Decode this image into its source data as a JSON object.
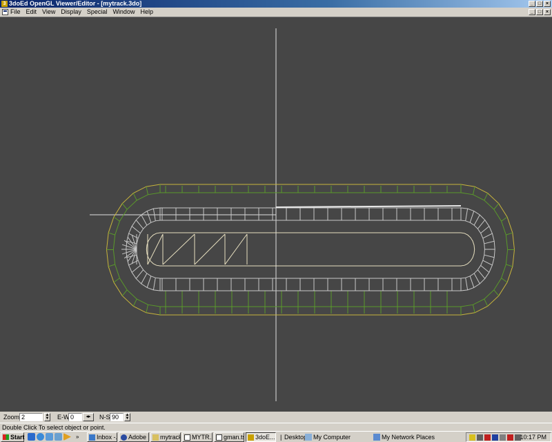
{
  "window": {
    "title": "3doEd OpenGL Viewer/Editor - [mytrack.3do]",
    "icon": "3",
    "controls": [
      "_",
      "□",
      "×"
    ]
  },
  "menu": {
    "items": [
      "File",
      "Edit",
      "View",
      "Display",
      "Special",
      "Window",
      "Help"
    ],
    "doc_controls": [
      "_",
      "□",
      "×"
    ]
  },
  "viewport": {
    "background": "#464646",
    "colors": {
      "axis": "#e0e0e0",
      "inner_wire": "#c8c8c8",
      "outer_wire": "#5a9a2a",
      "outline": "#c8b43c"
    }
  },
  "toolbar": {
    "zoom_label": "Zoom",
    "zoom_value": "2",
    "ew_label": "E-W",
    "ew_value": "0",
    "ns_label": "N-S",
    "ns_value": "90"
  },
  "status": {
    "text": "Double Click To select object or point."
  },
  "taskbar": {
    "start_label": "Start",
    "tasks": [
      "Inbox -...",
      "Adobe ...",
      "mytrack",
      "MYTR...",
      "gman.ts...",
      "3doE..."
    ],
    "desktop_label": "Desktop",
    "my_computer_label": "My Computer",
    "network_label": "My Network Places",
    "clock": "10:17 PM"
  }
}
